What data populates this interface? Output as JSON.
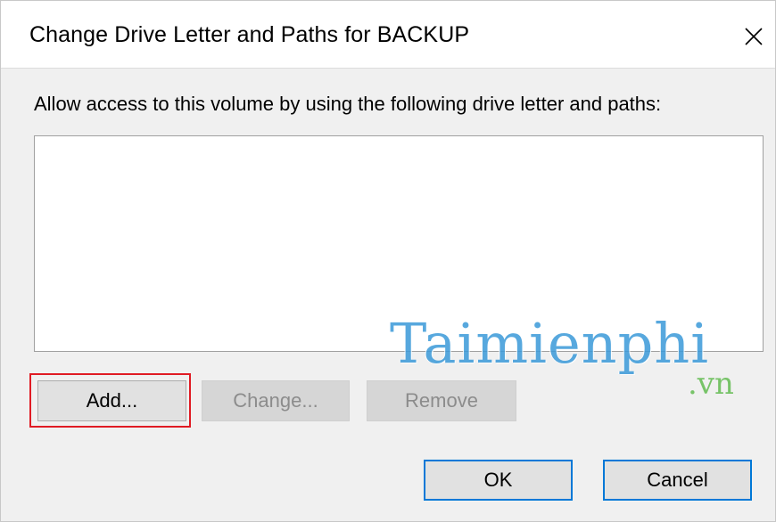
{
  "dialog": {
    "title": "Change Drive Letter and Paths for BACKUP",
    "prompt": "Allow access to this volume by using the following drive letter and paths:",
    "paths": [],
    "buttons": {
      "add": "Add...",
      "change": "Change...",
      "remove": "Remove",
      "ok": "OK",
      "cancel": "Cancel"
    }
  },
  "watermark": {
    "name": "Taimienphi",
    "suffix": ".vn"
  },
  "colors": {
    "highlight": "#e01b24",
    "default_button_border": "#0078d7",
    "watermark_blue": "#3a9ad9",
    "watermark_green": "#6bbf5a"
  },
  "icons": {
    "close": "close-icon"
  }
}
